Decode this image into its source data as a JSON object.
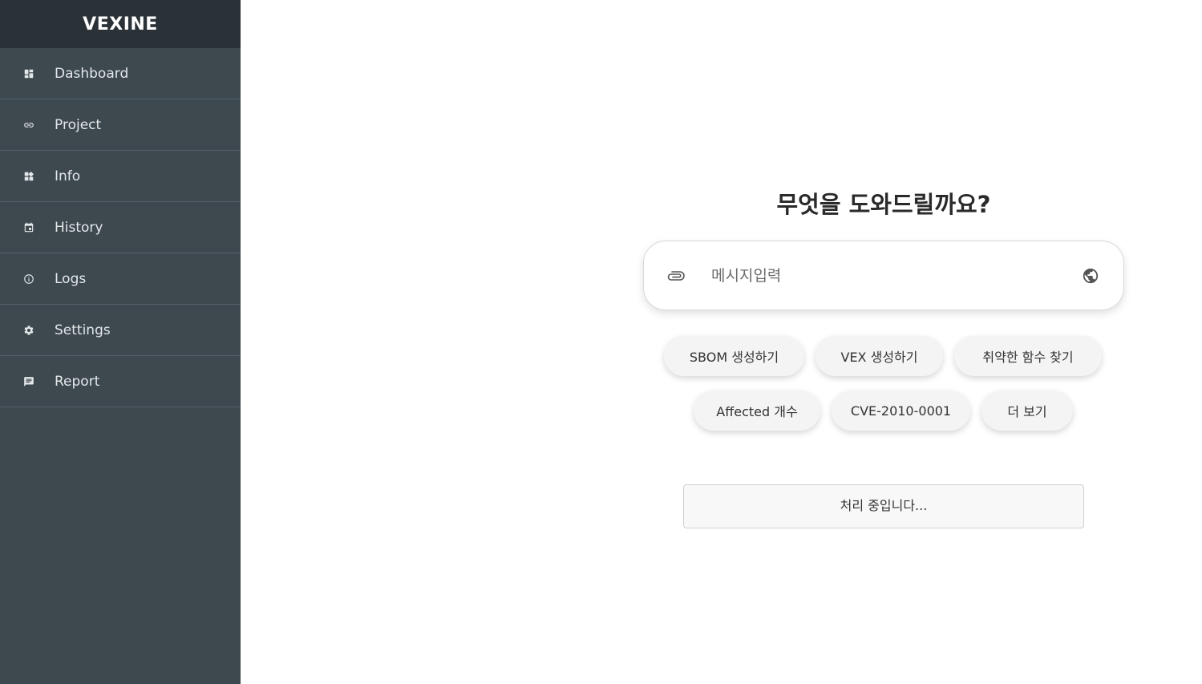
{
  "app": {
    "brand": "VEXINE"
  },
  "sidebar": {
    "items": [
      {
        "label": "Dashboard",
        "icon": "dashboard-icon"
      },
      {
        "label": "Project",
        "icon": "link-icon"
      },
      {
        "label": "Info",
        "icon": "widgets-icon"
      },
      {
        "label": "History",
        "icon": "calendar-icon"
      },
      {
        "label": "Logs",
        "icon": "info-circle-icon"
      },
      {
        "label": "Settings",
        "icon": "gear-icon"
      },
      {
        "label": "Report",
        "icon": "chat-bubble-icon"
      }
    ]
  },
  "main": {
    "heading": "무엇을 도와드릴까요?",
    "input": {
      "placeholder": "메시지입력",
      "value": ""
    },
    "suggestions": [
      "SBOM 생성하기",
      "VEX 생성하기",
      "취약한 함수 찾기",
      "Affected 개수",
      "CVE-2010-0001",
      "더 보기"
    ],
    "status": "처리 중입니다..."
  },
  "colors": {
    "sidebar_bg": "#3d484f",
    "brand_bg": "#2b3237",
    "text_dark": "#2a2a2a"
  }
}
